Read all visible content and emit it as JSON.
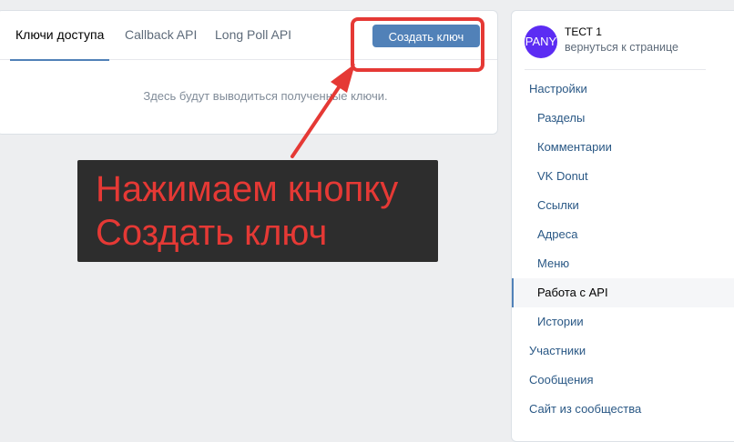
{
  "tabs": [
    {
      "label": "Ключи доступа",
      "active": true
    },
    {
      "label": "Callback API",
      "active": false
    },
    {
      "label": "Long Poll API",
      "active": false
    }
  ],
  "create_button": {
    "label": "Создать ключ"
  },
  "empty_message": "Здесь будут выводиться полученные ключи.",
  "annotation": {
    "lines": [
      "Нажимаем кнопку",
      "Создать ключ"
    ],
    "color": "#e53935",
    "background": "#2d2d2d"
  },
  "community": {
    "avatar_text": "PANY",
    "avatar_color": "#5c2cf3",
    "name": "ТЕСТ 1",
    "back_link": "вернуться к странице"
  },
  "menu": [
    {
      "label": "Настройки",
      "level": 1
    },
    {
      "label": "Разделы",
      "level": 2
    },
    {
      "label": "Комментарии",
      "level": 2
    },
    {
      "label": "VK Donut",
      "level": 2
    },
    {
      "label": "Ссылки",
      "level": 2
    },
    {
      "label": "Адреса",
      "level": 2
    },
    {
      "label": "Меню",
      "level": 2
    },
    {
      "label": "Работа с API",
      "level": 2,
      "selected": true
    },
    {
      "label": "Истории",
      "level": 2
    },
    {
      "label": "Участники",
      "level": 1
    },
    {
      "label": "Сообщения",
      "level": 1
    },
    {
      "label": "Сайт из сообщества",
      "level": 1
    }
  ],
  "colors": {
    "accent": "#5181b8",
    "link": "#2a5885",
    "highlight": "#e53935"
  }
}
